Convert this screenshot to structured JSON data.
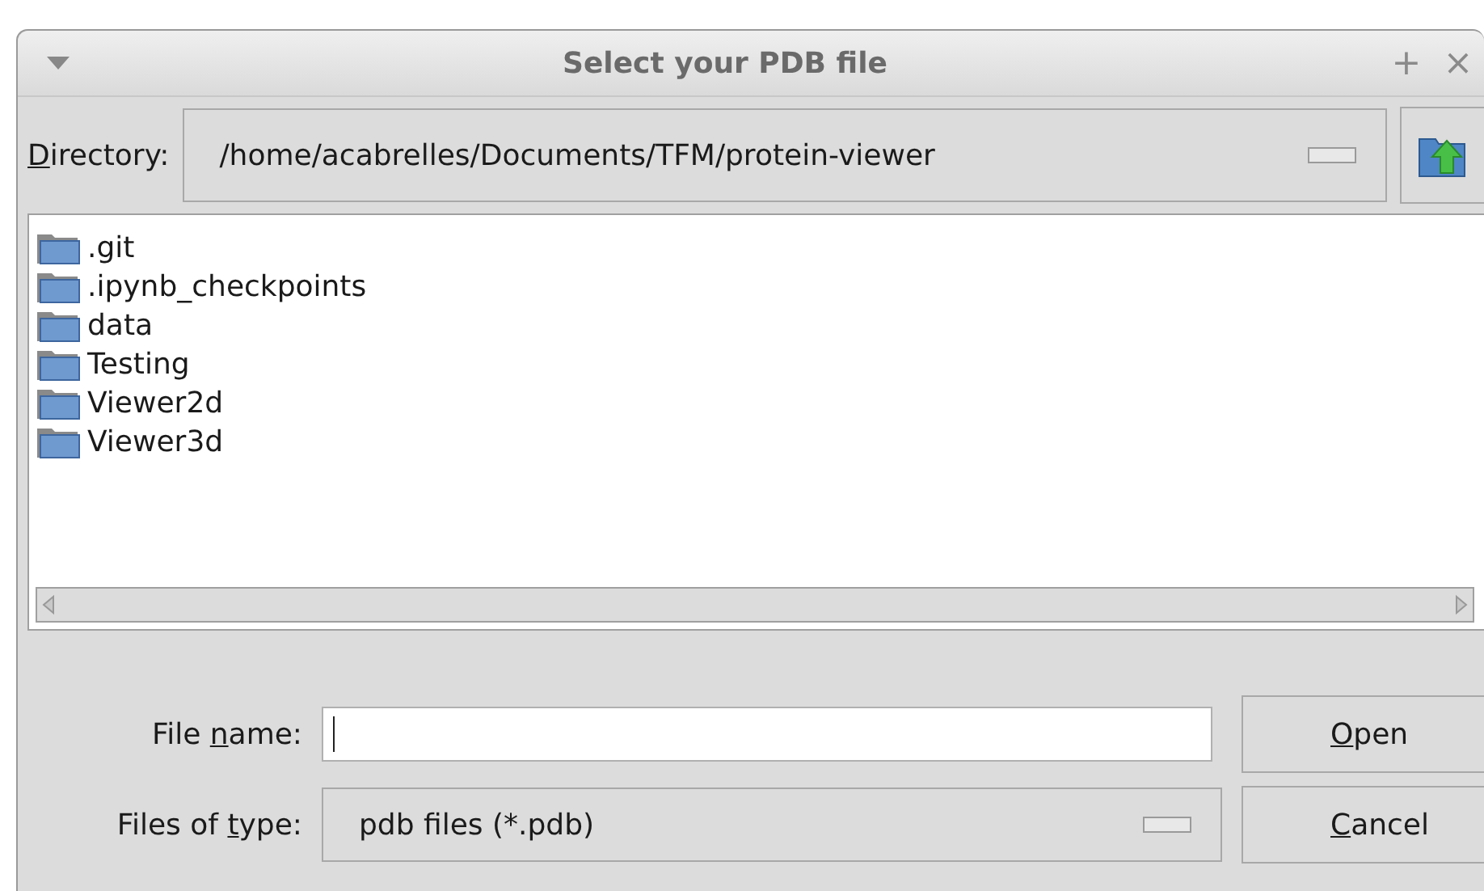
{
  "window": {
    "title": "Select your PDB file",
    "controls": [
      "+",
      "×"
    ]
  },
  "directory": {
    "label": {
      "accel": "D",
      "rest": "irectory:"
    },
    "value": "/home/acabrelles/Documents/TFM/protein-viewer"
  },
  "files": [
    {
      "name": ".git",
      "kind": "folder"
    },
    {
      "name": ".ipynb_checkpoints",
      "kind": "folder"
    },
    {
      "name": "data",
      "kind": "folder"
    },
    {
      "name": "Testing",
      "kind": "folder"
    },
    {
      "name": "Viewer2d",
      "kind": "folder"
    },
    {
      "name": "Viewer3d",
      "kind": "folder"
    }
  ],
  "file_name": {
    "label": {
      "lead": "File ",
      "accel": "n",
      "rest": "ame:"
    }
  },
  "file_type": {
    "label": {
      "lead": "Files of ",
      "accel": "t",
      "rest": "ype:"
    },
    "value": "pdb files (*.pdb)"
  },
  "buttons": [
    {
      "accel": "O",
      "rest": "pen"
    },
    {
      "accel": "C",
      "rest": "ancel"
    }
  ]
}
